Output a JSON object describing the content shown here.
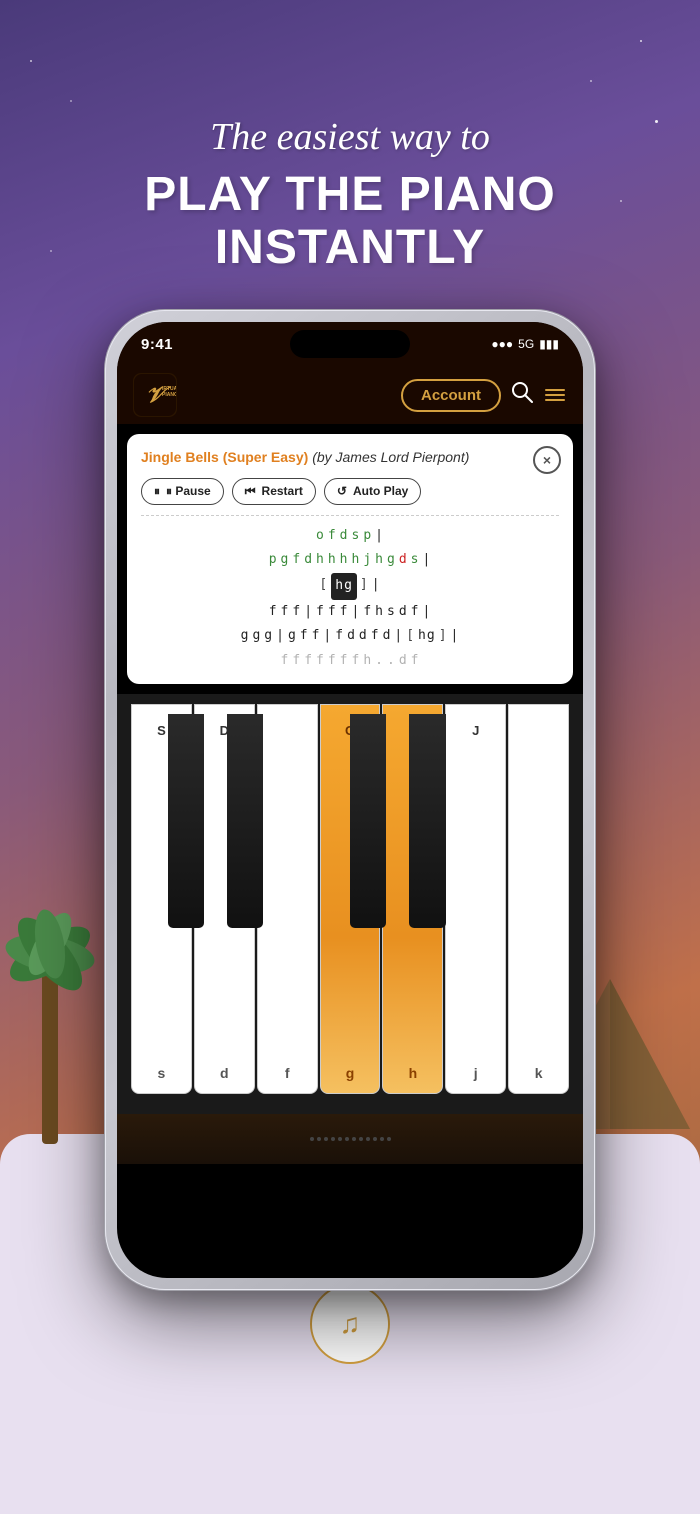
{
  "background": {
    "colors": [
      "#4a3a7a",
      "#6a4e9a",
      "#c0704a"
    ]
  },
  "headline": {
    "line1": "The easiest way to",
    "line2": "PLAY THE PIANO",
    "line3": "INSTANTLY"
  },
  "statusBar": {
    "time": "9:41",
    "signal": "●●●",
    "network": "5G",
    "battery": "▮▮▮"
  },
  "header": {
    "logoText1": "VIRTUAL",
    "logoText2": "PIANO",
    "logoSymbol": "𝒱",
    "accountLabel": "Account",
    "searchLabel": "search",
    "menuLabel": "menu"
  },
  "sheetMusic": {
    "titleMain": "Jingle Bells (Super Easy)",
    "titleSub": " (by James Lord Pierpont)",
    "closeLabel": "×",
    "controls": {
      "pause": "⏸ Pause",
      "restart": "⏮ Restart",
      "autoplay": "↺ Auto Play"
    },
    "noteRows": [
      {
        "notes": "o f d s p|",
        "style": "green"
      },
      {
        "notes": "p g f d h h h h j h g d s|",
        "style": "mixed"
      },
      {
        "notes": "[ hg ] |",
        "style": "highlighted"
      },
      {
        "notes": "f f f | f f f | f h s d f |",
        "style": "normal"
      },
      {
        "notes": "g g g | g f f | f d d f d | [ hg ] |",
        "style": "normal"
      },
      {
        "notes": "f f f f f f f h . . d f",
        "style": "faded"
      }
    ]
  },
  "piano": {
    "whiteKeys": [
      {
        "label": "s",
        "upperLabel": "S",
        "active": false
      },
      {
        "label": "d",
        "upperLabel": "D",
        "active": false
      },
      {
        "label": "f",
        "upperLabel": "",
        "active": false
      },
      {
        "label": "g",
        "upperLabel": "G",
        "active": true
      },
      {
        "label": "h",
        "upperLabel": "H",
        "active": true
      },
      {
        "label": "j",
        "upperLabel": "J",
        "active": false
      },
      {
        "label": "k",
        "upperLabel": "",
        "active": false
      }
    ],
    "blackKeys": [
      {
        "label": "",
        "position": 11.5
      },
      {
        "label": "",
        "position": 24.5
      },
      {
        "label": "",
        "position": 50.5
      },
      {
        "label": "",
        "position": 63.5
      }
    ]
  },
  "bottomSection": {
    "musicNoteIcon": "♫"
  }
}
